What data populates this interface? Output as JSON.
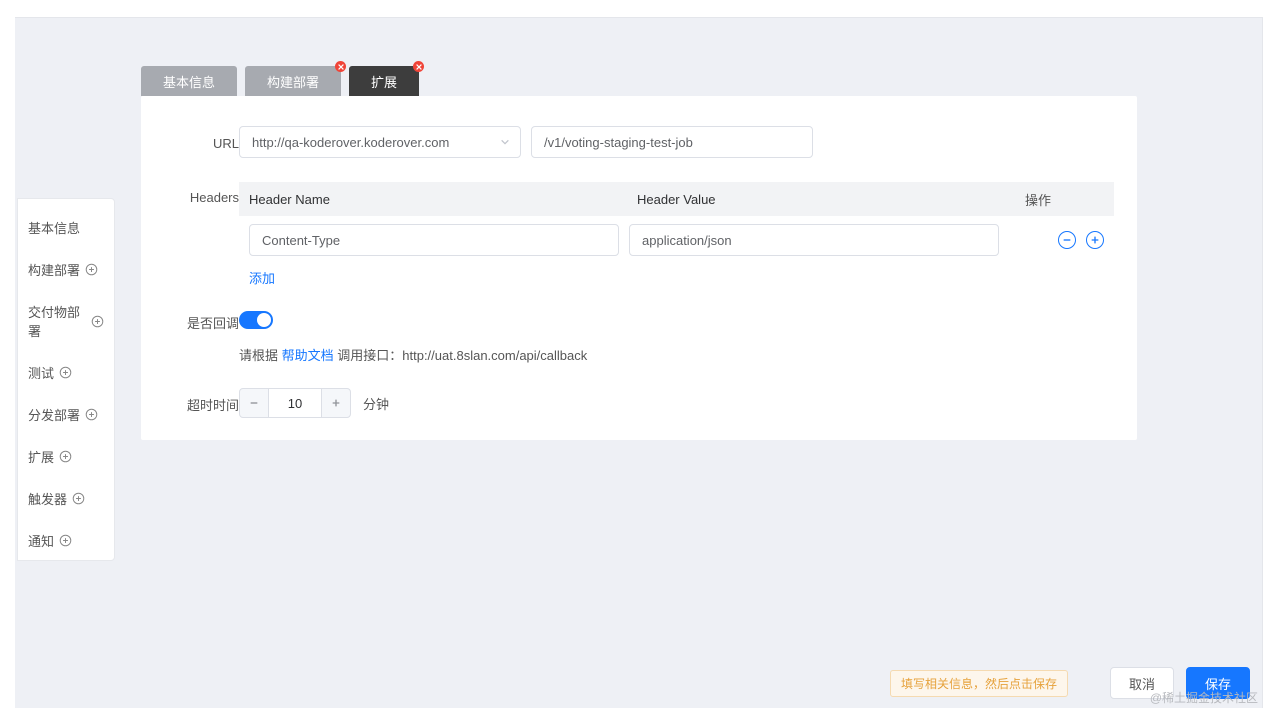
{
  "sidebar": {
    "items": [
      {
        "label": "基本信息",
        "has_plus": false
      },
      {
        "label": "构建部署",
        "has_plus": true
      },
      {
        "label": "交付物部署",
        "has_plus": true
      },
      {
        "label": "测试",
        "has_plus": true
      },
      {
        "label": "分发部署",
        "has_plus": true
      },
      {
        "label": "扩展",
        "has_plus": true
      },
      {
        "label": "触发器",
        "has_plus": true
      },
      {
        "label": "通知",
        "has_plus": true
      }
    ]
  },
  "tabs": [
    {
      "label": "基本信息",
      "variant": "gray",
      "closable": false
    },
    {
      "label": "构建部署",
      "variant": "gray",
      "closable": true
    },
    {
      "label": "扩展",
      "variant": "dark",
      "closable": true
    }
  ],
  "form": {
    "url_label": "URL",
    "url_host": "http://qa-koderover.koderover.com",
    "url_path": "/v1/voting-staging-test-job",
    "headers_label": "Headers",
    "headers_cols": {
      "name": "Header Name",
      "value": "Header Value",
      "op": "操作"
    },
    "headers": [
      {
        "name": "Content-Type",
        "value": "application/json"
      }
    ],
    "add_link": "添加",
    "callback_label": "是否回调",
    "callback_on": true,
    "callback_help_prefix": "请根据 ",
    "callback_help_link": "帮助文档",
    "callback_help_mid": " 调用接口：",
    "callback_url": "http://uat.8slan.com/api/callback",
    "timeout_label": "超时时间",
    "timeout_value": "10",
    "timeout_unit": "分钟"
  },
  "footer": {
    "hint": "填写相关信息，然后点击保存",
    "cancel": "取消",
    "save": "保存"
  },
  "watermark": "@稀土掘金技术社区",
  "colors": {
    "primary": "#1677ff",
    "danger": "#f04438"
  }
}
